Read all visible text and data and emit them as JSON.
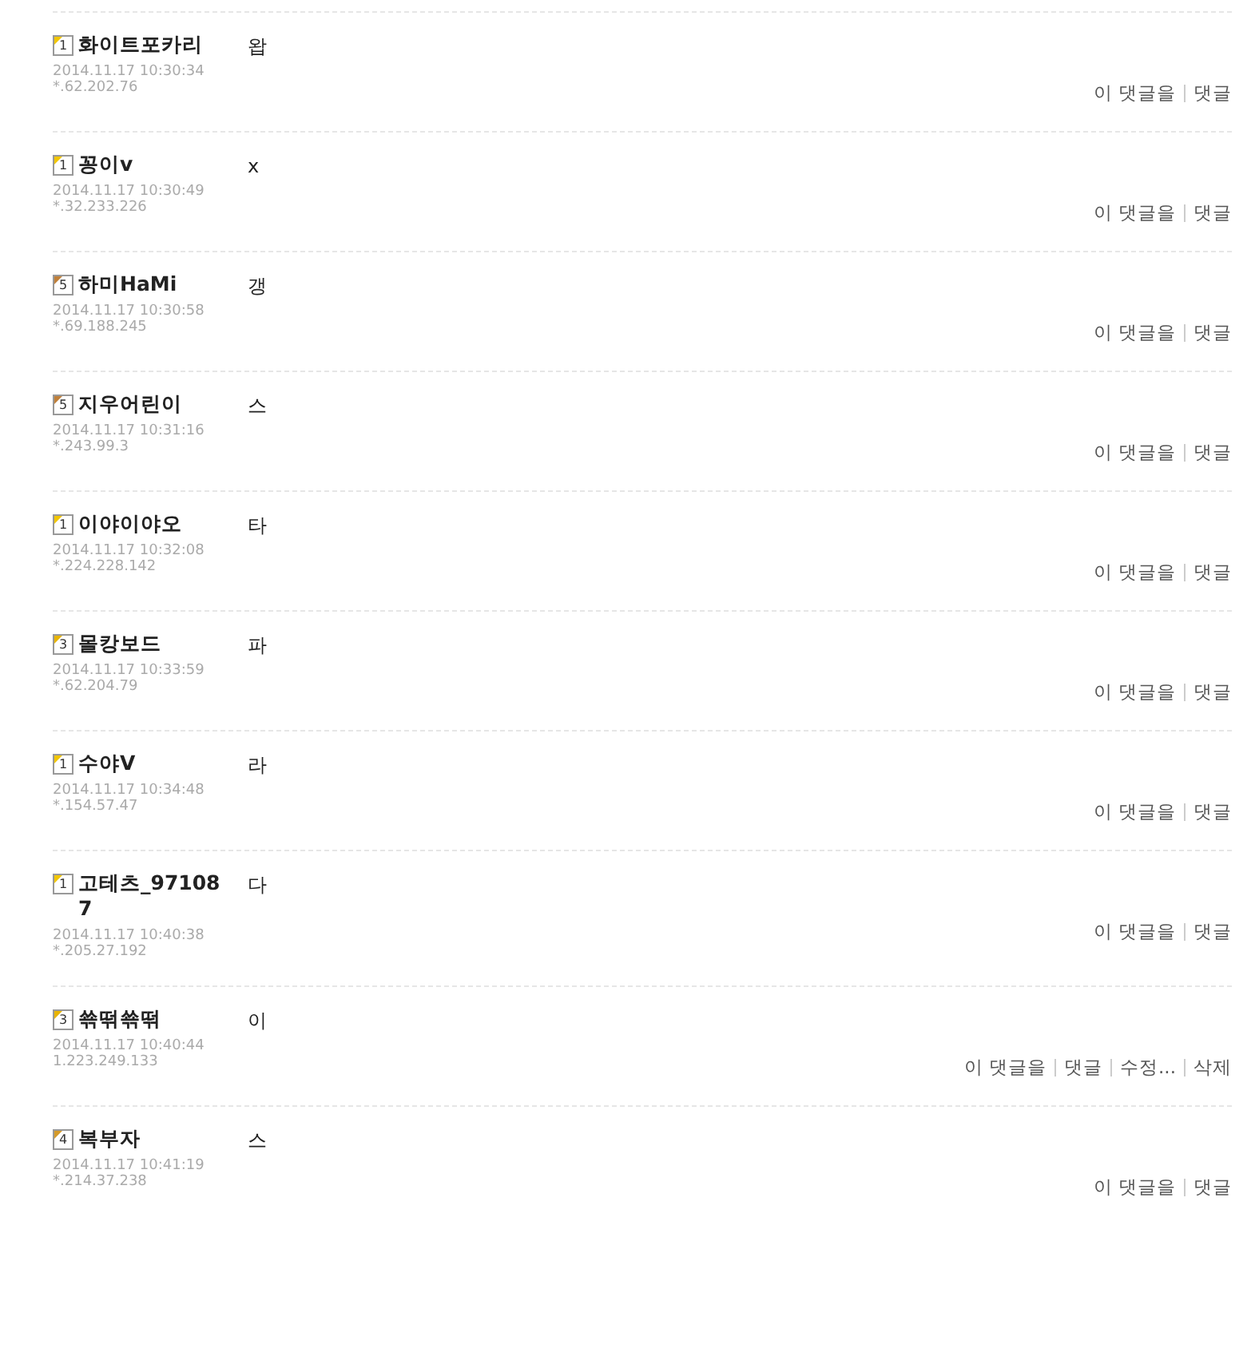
{
  "comments": [
    {
      "badge": "1",
      "color": "#f2c600",
      "author": "화이트포카리",
      "date": "2014.11.17 10:30:34",
      "ip": "*.62.202.76",
      "text": "왑",
      "actions": [
        "이 댓글을",
        "댓글"
      ]
    },
    {
      "badge": "1",
      "color": "#f2c600",
      "author": "꽁이v",
      "date": "2014.11.17 10:30:49",
      "ip": "*.32.233.226",
      "text": "x",
      "actions": [
        "이 댓글을",
        "댓글"
      ]
    },
    {
      "badge": "5",
      "color": "#c0803a",
      "author": "하미HaMi",
      "date": "2014.11.17 10:30:58",
      "ip": "*.69.188.245",
      "text": "갱",
      "actions": [
        "이 댓글을",
        "댓글"
      ]
    },
    {
      "badge": "5",
      "color": "#c0803a",
      "author": "지우어린이",
      "date": "2014.11.17 10:31:16",
      "ip": "*.243.99.3",
      "text": "스",
      "actions": [
        "이 댓글을",
        "댓글"
      ]
    },
    {
      "badge": "1",
      "color": "#f2c600",
      "author": "이야이야오",
      "date": "2014.11.17 10:32:08",
      "ip": "*.224.228.142",
      "text": "타",
      "actions": [
        "이 댓글을",
        "댓글"
      ]
    },
    {
      "badge": "3",
      "color": "#e8b400",
      "author": "몰캉보드",
      "date": "2014.11.17 10:33:59",
      "ip": "*.62.204.79",
      "text": "파",
      "actions": [
        "이 댓글을",
        "댓글"
      ]
    },
    {
      "badge": "1",
      "color": "#f2c600",
      "author": "수야V",
      "date": "2014.11.17 10:34:48",
      "ip": "*.154.57.47",
      "text": "라",
      "actions": [
        "이 댓글을",
        "댓글"
      ]
    },
    {
      "badge": "1",
      "color": "#f2c600",
      "author": "고테츠_971087",
      "date": "2014.11.17 10:40:38",
      "ip": "*.205.27.192",
      "text": "다",
      "actions": [
        "이 댓글을",
        "댓글"
      ]
    },
    {
      "badge": "3",
      "color": "#e8b400",
      "author": "쑊떢쑊떢",
      "date": "2014.11.17 10:40:44",
      "ip": "1.223.249.133",
      "text": "이",
      "actions": [
        "이 댓글을",
        "댓글",
        "수정...",
        "삭제"
      ]
    },
    {
      "badge": "4",
      "color": "#d49a2a",
      "author": "복부자",
      "date": "2014.11.17 10:41:19",
      "ip": "*.214.37.238",
      "text": "스",
      "actions": [
        "이 댓글을",
        "댓글"
      ]
    }
  ]
}
